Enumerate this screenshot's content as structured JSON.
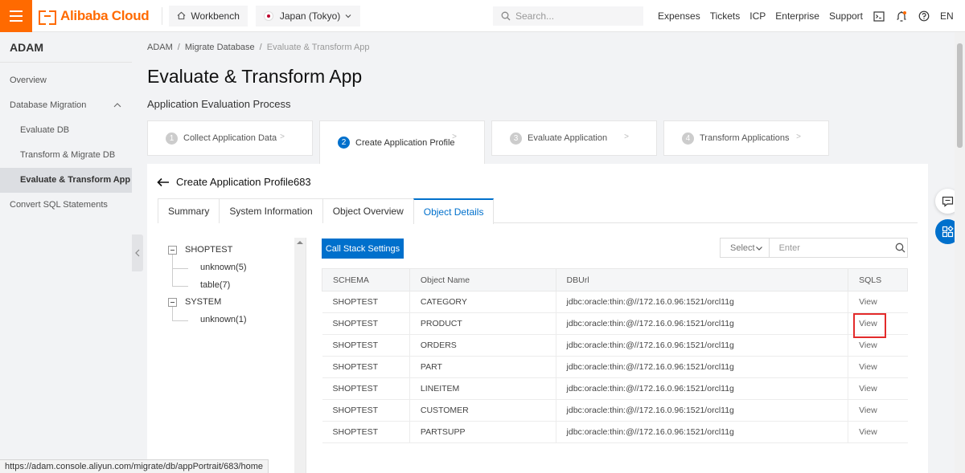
{
  "topbar": {
    "brand": "Alibaba Cloud",
    "workbench": "Workbench",
    "region": "Japan (Tokyo)",
    "search_placeholder": "Search...",
    "links": [
      "Expenses",
      "Tickets",
      "ICP",
      "Enterprise",
      "Support"
    ],
    "lang": "EN"
  },
  "sidebar": {
    "title": "ADAM",
    "items": [
      {
        "label": "Overview"
      },
      {
        "label": "Database Migration"
      },
      {
        "label": "Evaluate DB"
      },
      {
        "label": "Transform & Migrate DB"
      },
      {
        "label": "Evaluate & Transform App"
      },
      {
        "label": "Convert SQL Statements"
      }
    ]
  },
  "breadcrumb": [
    "ADAM",
    "Migrate Database",
    "Evaluate & Transform App"
  ],
  "page": {
    "title": "Evaluate & Transform App",
    "subtitle": "Application Evaluation Process"
  },
  "steps": [
    {
      "num": "1",
      "label": "Collect Application Data"
    },
    {
      "num": "2",
      "label": "Create Application Profile"
    },
    {
      "num": "3",
      "label": "Evaluate Application"
    },
    {
      "num": "4",
      "label": "Transform Applications"
    }
  ],
  "panel": {
    "title": "Create Application Profile683",
    "tabs": [
      "Summary",
      "System Information",
      "Object Overview",
      "Object Details"
    ],
    "tree": {
      "n0": "SHOPTEST",
      "n0a": "unknown(5)",
      "n0b": "table(7)",
      "n1": "SYSTEM",
      "n1a": "unknown(1)"
    },
    "call_stack_button": "Call Stack Settings",
    "filter": {
      "select": "Select",
      "placeholder": "Enter"
    },
    "table": {
      "headers": [
        "SCHEMA",
        "Object Name",
        "DBUrl",
        "SQLS"
      ],
      "rows": [
        {
          "schema": "SHOPTEST",
          "name": "CATEGORY",
          "url": "jdbc:oracle:thin:@//172.16.0.96:1521/orcl11g",
          "sqls": "View"
        },
        {
          "schema": "SHOPTEST",
          "name": "PRODUCT",
          "url": "jdbc:oracle:thin:@//172.16.0.96:1521/orcl11g",
          "sqls": "View"
        },
        {
          "schema": "SHOPTEST",
          "name": "ORDERS",
          "url": "jdbc:oracle:thin:@//172.16.0.96:1521/orcl11g",
          "sqls": "View"
        },
        {
          "schema": "SHOPTEST",
          "name": "PART",
          "url": "jdbc:oracle:thin:@//172.16.0.96:1521/orcl11g",
          "sqls": "View"
        },
        {
          "schema": "SHOPTEST",
          "name": "LINEITEM",
          "url": "jdbc:oracle:thin:@//172.16.0.96:1521/orcl11g",
          "sqls": "View"
        },
        {
          "schema": "SHOPTEST",
          "name": "CUSTOMER",
          "url": "jdbc:oracle:thin:@//172.16.0.96:1521/orcl11g",
          "sqls": "View"
        },
        {
          "schema": "SHOPTEST",
          "name": "PARTSUPP",
          "url": "jdbc:oracle:thin:@//172.16.0.96:1521/orcl11g",
          "sqls": "View"
        }
      ]
    }
  },
  "status_url": "https://adam.console.aliyun.com/migrate/db/appPortrait/683/home",
  "colors": {
    "brand": "#ff6a00",
    "primary": "#0070cc",
    "highlight": "#e32b2b"
  },
  "icons": [
    "menu-icon",
    "home-icon",
    "flag-icon",
    "chevron-down-icon",
    "search-icon",
    "terminal-icon",
    "bell-icon",
    "help-icon",
    "avatar",
    "chevron-up-icon",
    "chevron-left-icon",
    "back-arrow-icon",
    "chat-icon",
    "apps-icon"
  ]
}
